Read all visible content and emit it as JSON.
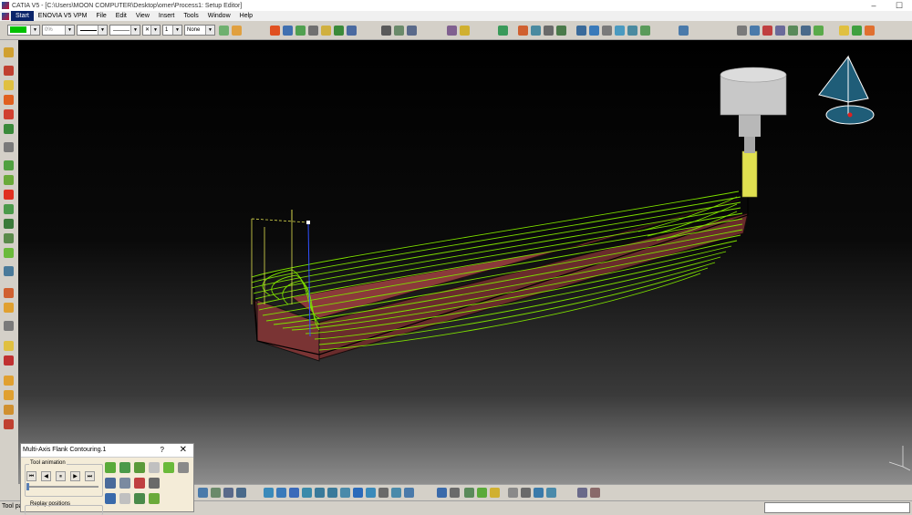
{
  "window": {
    "title": "CATIA V5 - [C:\\Users\\MOON COMPUTER\\Desktop\\omer\\Process1: Setup Editor]",
    "minimize": "–",
    "maximize": "☐"
  },
  "menu": [
    {
      "label": "Start",
      "active": true
    },
    {
      "label": "ENOVIA V5 VPM",
      "active": false
    },
    {
      "label": "File",
      "active": false
    },
    {
      "label": "Edit",
      "active": false
    },
    {
      "label": "View",
      "active": false
    },
    {
      "label": "Insert",
      "active": false
    },
    {
      "label": "Tools",
      "active": false
    },
    {
      "label": "Window",
      "active": false
    },
    {
      "label": "Help",
      "active": false
    }
  ],
  "graphic_properties": {
    "fill_color": "#00c000",
    "transparency": "0%",
    "line_weight": "1",
    "layer": "None"
  },
  "dialog": {
    "title": "Multi-Axis Flank Contouring.1",
    "help": "?",
    "close": "✕",
    "tool_animation_label": "Tool animation",
    "replay_positions_label": "Replay positions",
    "player": [
      "⏮",
      "◀",
      "⏸",
      "▶",
      "⏭"
    ]
  },
  "status": {
    "text": "Tool pa"
  },
  "colors": {
    "toolpath": "#7ee000",
    "stock": "#7a3434",
    "tool_holder": "#c8c8c8",
    "tool_flute": "#e0e050",
    "compass_fill": "#1f5d78",
    "menu_active": "#0a246a"
  }
}
